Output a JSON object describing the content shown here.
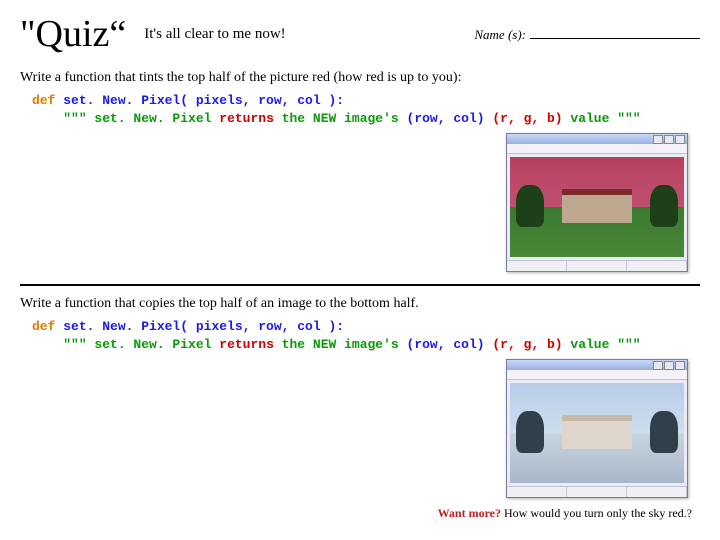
{
  "header": {
    "title": "\"Quiz“",
    "subtitle": "It's all clear to me now!",
    "name_label": "Name (s):"
  },
  "q1": {
    "prompt": "Write a function that tints the top half of the picture red (how red is up to you):",
    "code": {
      "def": "def",
      "fn": "set. New. Pixel( pixels, row, col ):",
      "doc_open": "\"\"\" set. New. Pixel",
      "returns": "returns",
      "mid": "the NEW image's",
      "coords": "(row, col)",
      "val": "(r, g, b)",
      "tail": "value \"\"\""
    }
  },
  "q2": {
    "prompt": "Write a function that copies the top half of an image to the bottom half.",
    "code": {
      "def": "def",
      "fn": "set. New. Pixel( pixels, row, col ):",
      "doc_open": "\"\"\" set. New. Pixel",
      "returns": "returns",
      "mid": "the NEW image's",
      "coords": "(row, col)",
      "val": "(r, g, b)",
      "tail": "value \"\"\""
    }
  },
  "footer": {
    "lead": "Want more?",
    "rest": " How would you turn only the sky red.?"
  }
}
